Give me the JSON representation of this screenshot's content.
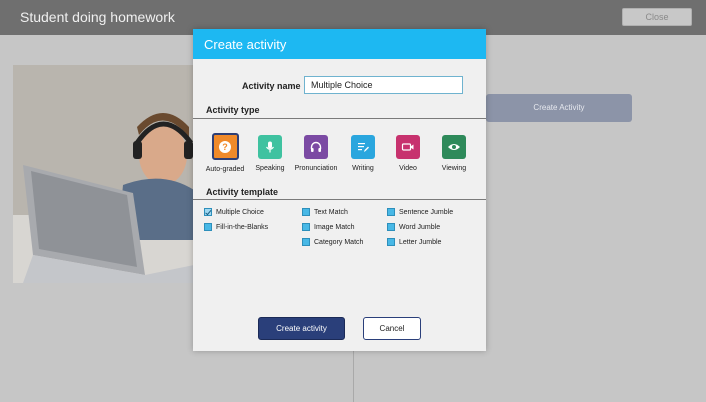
{
  "app": {
    "title": "Student doing homework",
    "close_label": "Close",
    "create_activity_button": "Create Activity"
  },
  "modal": {
    "title": "Create activity",
    "name_label": "Activity name",
    "name_value": "Multiple Choice",
    "activity_type_heading": "Activity type",
    "activity_types": [
      {
        "label": "Auto-graded",
        "icon": "question-icon",
        "color": "#f08a2a",
        "selected": true
      },
      {
        "label": "Speaking",
        "icon": "microphone-icon",
        "color": "#3fc2a0",
        "selected": false
      },
      {
        "label": "Pronunciation",
        "icon": "headphones-icon",
        "color": "#7b4aa3",
        "selected": false
      },
      {
        "label": "Writing",
        "icon": "pencil-lines-icon",
        "color": "#2aa6de",
        "selected": false
      },
      {
        "label": "Video",
        "icon": "video-camera-icon",
        "color": "#c7326e",
        "selected": false
      },
      {
        "label": "Viewing",
        "icon": "eye-icon",
        "color": "#2e8a5a",
        "selected": false
      }
    ],
    "template_heading": "Activity template",
    "templates": [
      {
        "label": "Multiple Choice",
        "checked": true
      },
      {
        "label": "Fill-in-the-Blanks",
        "checked": false
      },
      {
        "label": "Text Match",
        "checked": false
      },
      {
        "label": "Image Match",
        "checked": false
      },
      {
        "label": "Category Match",
        "checked": false
      },
      {
        "label": "Sentence Jumble",
        "checked": false
      },
      {
        "label": "Word Jumble",
        "checked": false
      },
      {
        "label": "Letter Jumble",
        "checked": false
      }
    ],
    "create_label": "Create activity",
    "cancel_label": "Cancel"
  },
  "colors": {
    "header_accent": "#1db8f2",
    "primary_button": "#2a3f7a",
    "checkbox": "#48b8e6"
  }
}
